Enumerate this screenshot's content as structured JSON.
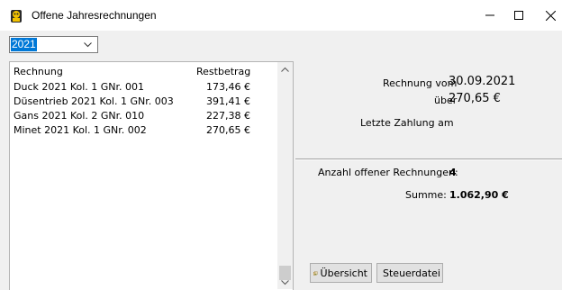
{
  "window": {
    "title": "Offene Jahresrechnungen"
  },
  "year_select": {
    "value": "2021"
  },
  "list": {
    "headers": {
      "invoice": "Rechnung",
      "amount": "Restbetrag"
    },
    "rows": [
      {
        "invoice": "Duck 2021 Kol. 1 GNr. 001",
        "amount": "173,46 €"
      },
      {
        "invoice": "Düsentrieb 2021 Kol. 1 GNr. 003",
        "amount": "391,41 €"
      },
      {
        "invoice": "Gans 2021 Kol. 2 GNr. 010",
        "amount": "227,38 €"
      },
      {
        "invoice": "Minet 2021 Kol. 1 GNr. 002",
        "amount": "270,65 €"
      }
    ]
  },
  "detail": {
    "invoice_from_label": "Rechnung vom",
    "invoice_from_value": "30.09.2021",
    "over_label": "über",
    "over_value": "270,65 €",
    "last_payment_label": "Letzte Zahlung am"
  },
  "summary": {
    "count_label": "Anzahl offener Rechnungen:",
    "count_value": "4",
    "sum_label": "Summe:",
    "sum_value": "1.062,90 €"
  },
  "buttons": {
    "overview": "Übersicht",
    "tax_file": "Steuerdatei"
  },
  "colors": {
    "selection": "#0078d7",
    "window_bg": "#f0f0f0"
  }
}
